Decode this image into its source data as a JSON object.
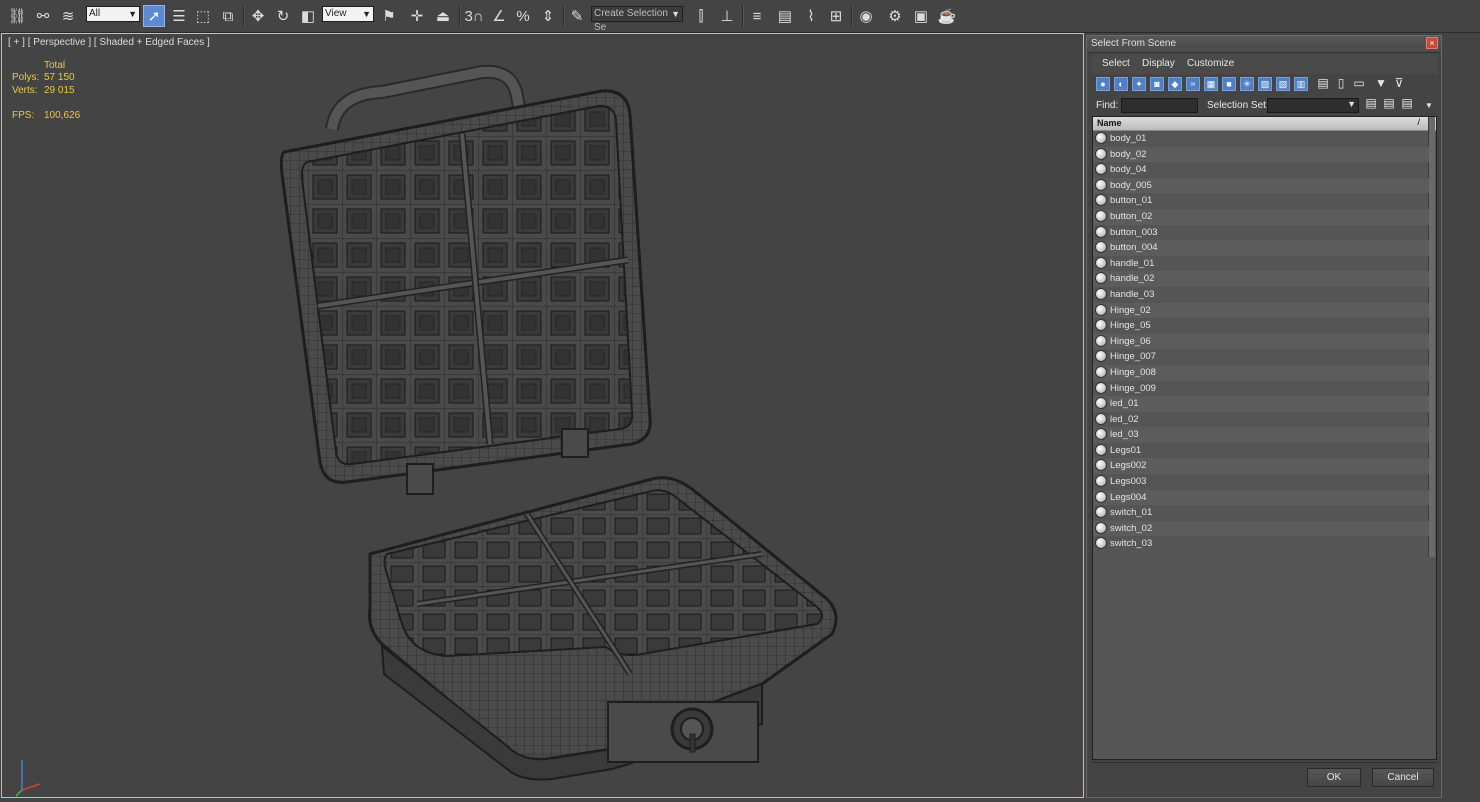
{
  "toolbar": {
    "selection_filter": "All",
    "reference_coord": "View",
    "named_selection_placeholder": "Create Selection Se",
    "snap_toggle_label": "3",
    "icons": [
      "link-icon",
      "unlink-icon",
      "bind-spacewarp-icon",
      "select-object-icon",
      "select-by-name-icon",
      "rect-region-icon",
      "window-crossing-icon",
      "move-icon",
      "rotate-icon",
      "scale-icon",
      "pivot-icon",
      "manipulate-icon",
      "keyboard-shortcut-icon",
      "snaps-icon",
      "angle-snap-icon",
      "percent-snap-icon",
      "spinner-snap-icon",
      "edit-named-sets-icon",
      "mirror-icon",
      "align-icon",
      "layer-manager-icon",
      "ribbon-icon",
      "curve-editor-icon",
      "schematic-view-icon",
      "material-editor-icon",
      "render-setup-icon",
      "rendered-frame-icon",
      "render-icon"
    ]
  },
  "viewport": {
    "label": "[ + ] [ Perspective ] [ Shaded + Edged Faces ]",
    "stats": {
      "total_label": "Total",
      "polys_label": "Polys:",
      "polys_value": "57 150",
      "verts_label": "Verts:",
      "verts_value": "29 015",
      "fps_label": "FPS:",
      "fps_value": "100,626"
    }
  },
  "dialog": {
    "title": "Select From Scene",
    "close_label": "×",
    "menu": [
      "Select",
      "Display",
      "Customize"
    ],
    "find_label": "Find:",
    "selection_set_label": "Selection Set:",
    "column_header": "Name",
    "sort_indicator": "/",
    "objects": [
      "body_01",
      "body_02",
      "body_04",
      "body_005",
      "button_01",
      "button_02",
      "button_003",
      "button_004",
      "handle_01",
      "handle_02",
      "handle_03",
      "Hinge_02",
      "Hinge_05",
      "Hinge_06",
      "Hinge_007",
      "Hinge_008",
      "Hinge_009",
      "led_01",
      "led_02",
      "led_03",
      "Legs01",
      "Legs002",
      "Legs003",
      "Legs004",
      "switch_01",
      "switch_02",
      "switch_03"
    ],
    "ok_label": "OK",
    "cancel_label": "Cancel"
  },
  "colors": {
    "background": "#444444",
    "active_accent": "#5b8ad1",
    "stats_text": "#e8c84a",
    "viewport_border": "#dcc55a",
    "close_button": "#c64a3e"
  }
}
